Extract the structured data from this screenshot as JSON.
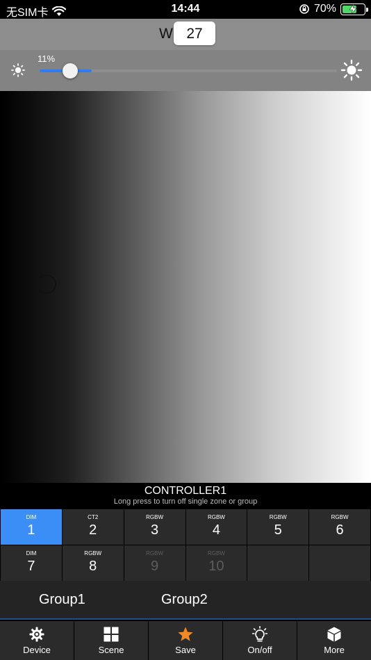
{
  "status": {
    "carrier": "无SIM卡",
    "time": "14:44",
    "battery_percent": "70%",
    "battery_level": 0.7
  },
  "w_bar": {
    "label": "W",
    "value": "27"
  },
  "brightness": {
    "percent_label": "11%",
    "level": 0.11,
    "accent_color": "#2f7bf5"
  },
  "picker": {
    "cursor_icon": "circle-cursor"
  },
  "controller": {
    "name": "CONTROLLER1",
    "hint": "Long press to turn off single zone or group"
  },
  "zones": [
    {
      "type": "DIM",
      "number": "1",
      "state": "active"
    },
    {
      "type": "CT2",
      "number": "2",
      "state": "normal"
    },
    {
      "type": "RGBW",
      "number": "3",
      "state": "normal"
    },
    {
      "type": "RGBW",
      "number": "4",
      "state": "normal"
    },
    {
      "type": "RGBW",
      "number": "5",
      "state": "normal"
    },
    {
      "type": "RGBW",
      "number": "6",
      "state": "normal"
    },
    {
      "type": "DIM",
      "number": "7",
      "state": "normal"
    },
    {
      "type": "RGBW",
      "number": "8",
      "state": "normal"
    },
    {
      "type": "RGBW",
      "number": "9",
      "state": "disabled"
    },
    {
      "type": "RGBW",
      "number": "10",
      "state": "disabled"
    },
    {
      "type": "",
      "number": "",
      "state": "empty"
    },
    {
      "type": "",
      "number": "",
      "state": "empty"
    }
  ],
  "groups": {
    "group1": "Group1",
    "group2": "Group2"
  },
  "tabs": {
    "device": {
      "label": "Device",
      "icon": "gear-icon"
    },
    "scene": {
      "label": "Scene",
      "icon": "grid-icon"
    },
    "save": {
      "label": "Save",
      "icon": "star-icon",
      "color": "#f08a24"
    },
    "onoff": {
      "label": "On/off",
      "icon": "bulb-icon"
    },
    "more": {
      "label": "More",
      "icon": "cube-icon"
    }
  }
}
